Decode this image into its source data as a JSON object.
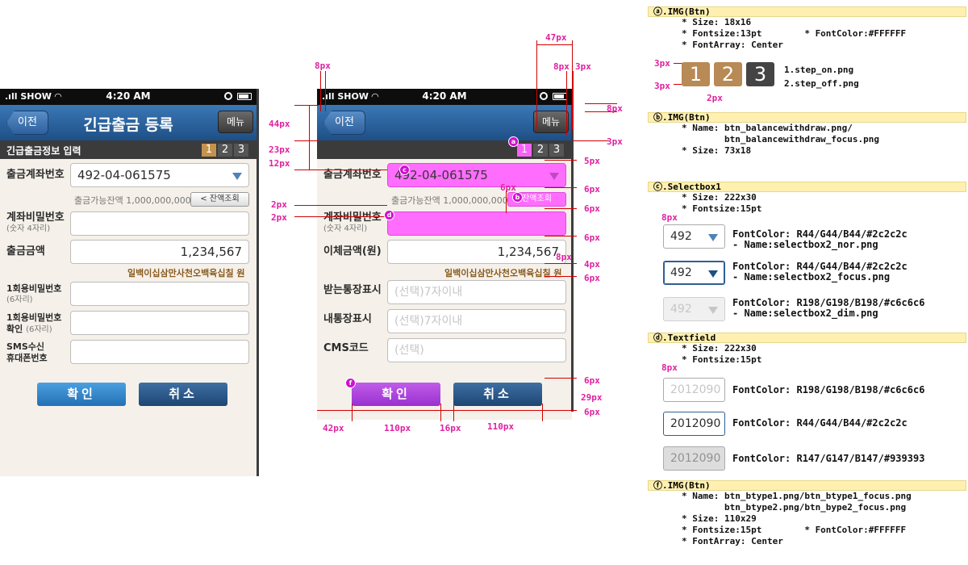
{
  "status": {
    "carrier": "SHOW",
    "time": "4:20 AM"
  },
  "titlebar": {
    "back": "이전",
    "title": "긴급출금 등록",
    "menu": "메뉴"
  },
  "sub": {
    "label": "긴급출금정보 입력",
    "steps": [
      "1",
      "2",
      "3"
    ]
  },
  "fields": {
    "account": {
      "label": "출금계좌번호",
      "value": "492-04-061575"
    },
    "balance": {
      "text": "출금가능잔액 1,000,000,000원",
      "button": "< 잔액조회",
      "button2": "잔액조회"
    },
    "password": {
      "label": "계좌비밀번호",
      "sub": "(숫자 4자리)"
    },
    "amount": {
      "label": "출금금액",
      "label2": "이체금액(원)",
      "value": "1,234,567",
      "hangul": "일백이십삼만사천오백육십칠 원"
    },
    "otp": {
      "label": "1회용비밀번호",
      "sub": "(6자리)"
    },
    "otp_confirm": {
      "label": "1회용비밀번호",
      "label2": "확인",
      "sub": "(6자리)"
    },
    "sms": {
      "label": "SMS수신",
      "label2": "휴대폰번호"
    },
    "recv": {
      "label": "받는통장표시",
      "placeholder": "(선택)7자이내"
    },
    "mine": {
      "label": "내통장표시",
      "placeholder": "(선택)7자이내"
    },
    "cms": {
      "label": "CMS코드",
      "placeholder": "(선택)"
    }
  },
  "buttons": {
    "ok": "확인",
    "cancel": "취소"
  },
  "measures": {
    "m47": "47px",
    "m8a": "8px",
    "m8b": "8px",
    "m3a": "3px",
    "m8c": "8px",
    "m44": "44px",
    "m3b": "3px",
    "m23": "23px",
    "m12": "12px",
    "m5": "5px",
    "m6a": "6px",
    "m6b": "6px",
    "m2a": "2px",
    "m6c": "6px",
    "m2b": "2px",
    "m6d": "6px",
    "m4": "4px",
    "m8d": "8px",
    "m6e": "6px",
    "m6f": "6px",
    "m29": "29px",
    "m6g": "6px",
    "m42": "42px",
    "m110a": "110px",
    "m16": "16px",
    "m110b": "110px"
  },
  "circles": {
    "a": "a",
    "b": "b",
    "c": "c",
    "d": "d",
    "f": "f"
  },
  "spec": {
    "a": {
      "head": "ⓐ.IMG(Btn)",
      "l1": "* Size: 18x16",
      "l2": "* Fontsize:13pt        * FontColor:#FFFFFF",
      "l3": "* FontArray: Center",
      "px3a": "3px",
      "px3b": "3px",
      "px2": "2px",
      "n1": "1.step_on.png",
      "n2": "2.step_off.png",
      "i1": "1",
      "i2": "2",
      "i3": "3"
    },
    "b": {
      "head": "ⓑ.IMG(Btn)",
      "l1": "* Name: btn_balancewithdraw.png/",
      "l2": "        btn_balancewithdraw_focus.png",
      "l3": "* Size: 73x18"
    },
    "c": {
      "head": "ⓒ.Selectbox1",
      "l1": "* Size: 222x30",
      "l2": "* Fontsize:15pt",
      "px8": "8px",
      "v": "492",
      "t1": "FontColor: R44/G44/B44/#2c2c2c\n- Name:selectbox2_nor.png",
      "t2": "FontColor: R44/G44/B44/#2c2c2c\n- Name:selectbox2_focus.png",
      "t3": "FontColor: R198/G198/B198/#c6c6c6\n- Name:selectbox2_dim.png"
    },
    "d": {
      "head": "ⓓ.Textfield",
      "l1": "* Size: 222x30",
      "l2": "* Fontsize:15pt",
      "px8": "8px",
      "v": "2012090",
      "t1": "FontColor: R198/G198/B198/#c6c6c6",
      "t2": "FontColor: R44/G44/B44/#2c2c2c",
      "t3": "FontColor: R147/G147/B147/#939393"
    },
    "f": {
      "head": "ⓕ.IMG(Btn)",
      "l1": "* Name: btn_btype1.png/btn_btype1_focus.png",
      "l2": "        btn_btype2.png/btn_bype2_focus.png",
      "l3": "* Size: 110x29",
      "l4": "* Fontsize:15pt        * FontColor:#FFFFFF",
      "l5": "* FontArray: Center"
    }
  }
}
